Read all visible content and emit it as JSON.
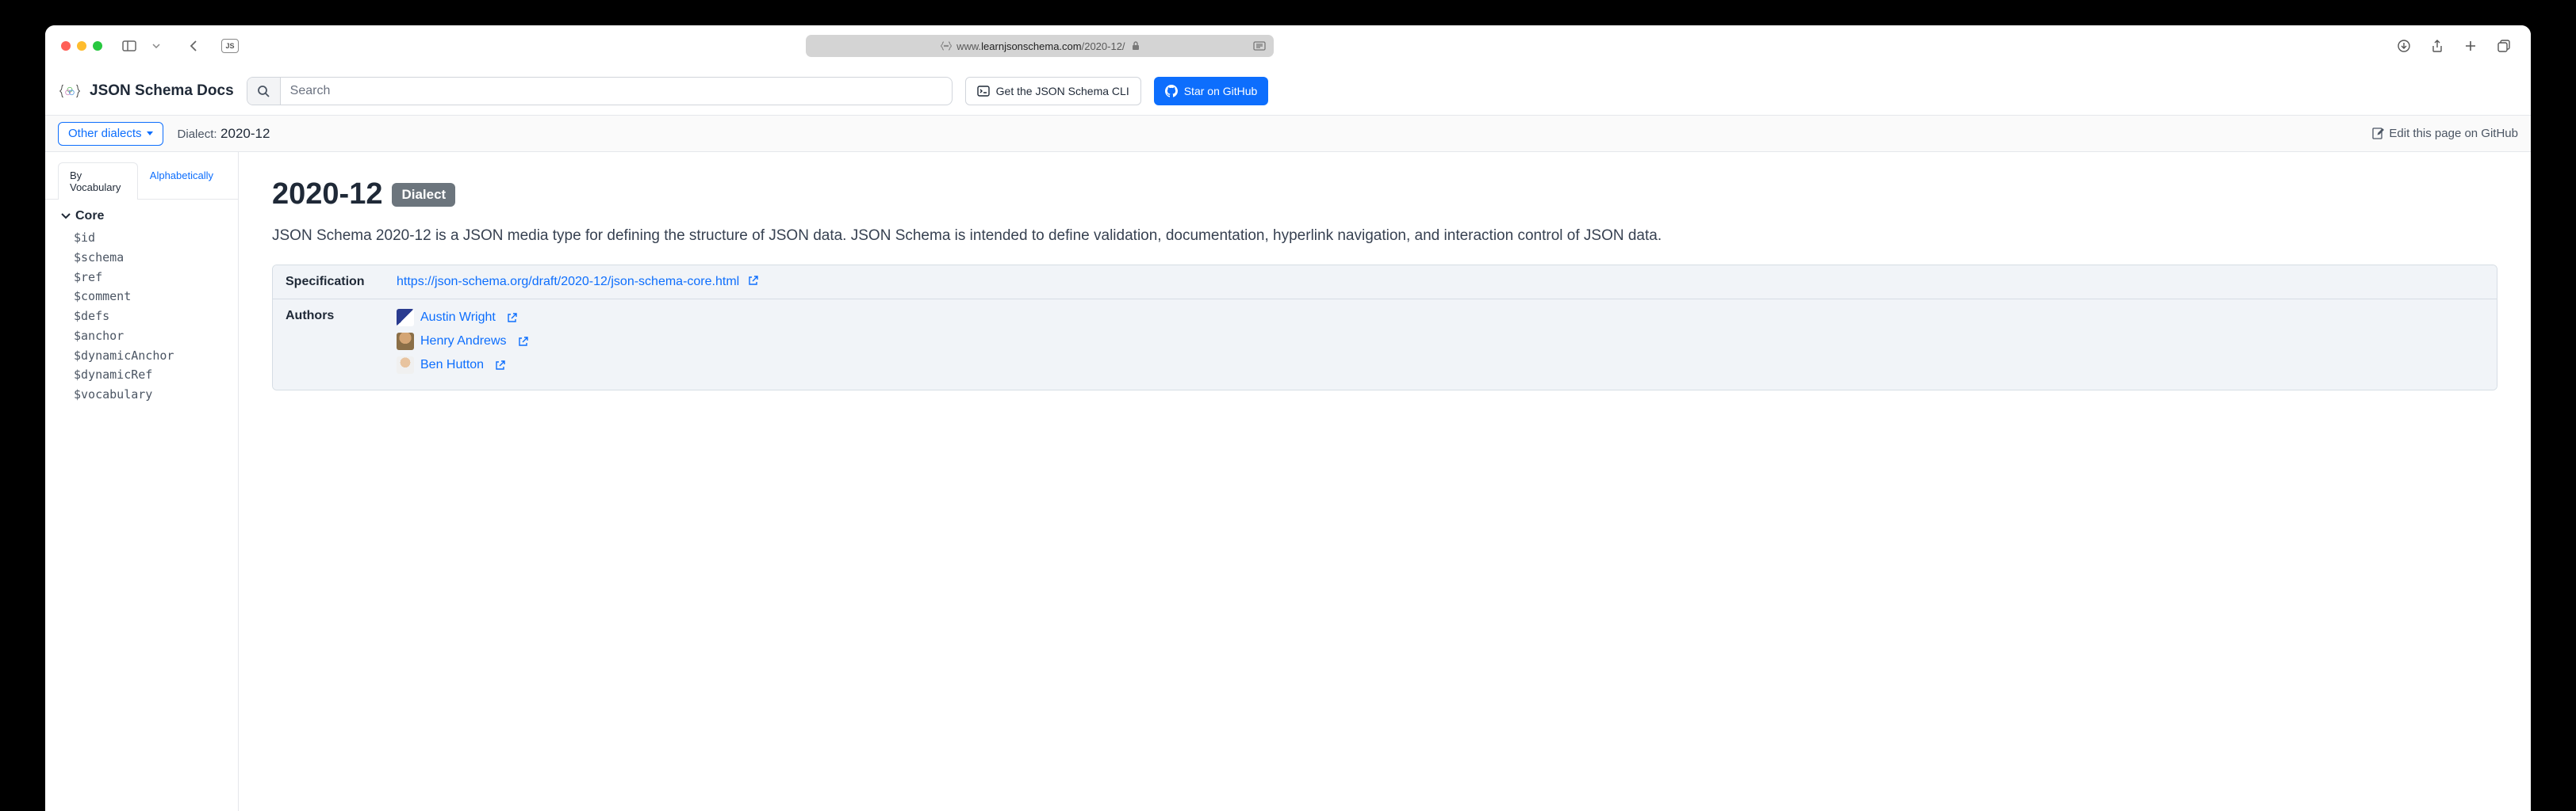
{
  "browser": {
    "url_display_prefix": "www.",
    "url_display_domain": "learnjsonschema.com",
    "url_display_path": "/2020-12/",
    "js_badge": "JS"
  },
  "header": {
    "logo_text": "JSON Schema Docs",
    "search_placeholder": "Search",
    "cli_button": "Get the JSON Schema CLI",
    "star_button": "Star on GitHub"
  },
  "subheader": {
    "dialects_button": "Other dialects",
    "dialect_label": "Dialect:",
    "dialect_value": "2020-12",
    "edit_link": "Edit this page on GitHub"
  },
  "sidebar": {
    "tabs": {
      "by_vocabulary": "By Vocabulary",
      "alphabetically": "Alphabetically"
    },
    "section_core": {
      "title": "Core",
      "items": [
        "$id",
        "$schema",
        "$ref",
        "$comment",
        "$defs",
        "$anchor",
        "$dynamicAnchor",
        "$dynamicRef",
        "$vocabulary"
      ]
    }
  },
  "main": {
    "title": "2020-12",
    "badge": "Dialect",
    "description": "JSON Schema 2020-12 is a JSON media type for defining the structure of JSON data. JSON Schema is intended to define validation, documentation, hyperlink navigation, and interaction control of JSON data.",
    "spec_label": "Specification",
    "spec_url": "https://json-schema.org/draft/2020-12/json-schema-core.html",
    "authors_label": "Authors",
    "authors": [
      "Austin Wright",
      "Henry Andrews",
      "Ben Hutton"
    ]
  }
}
